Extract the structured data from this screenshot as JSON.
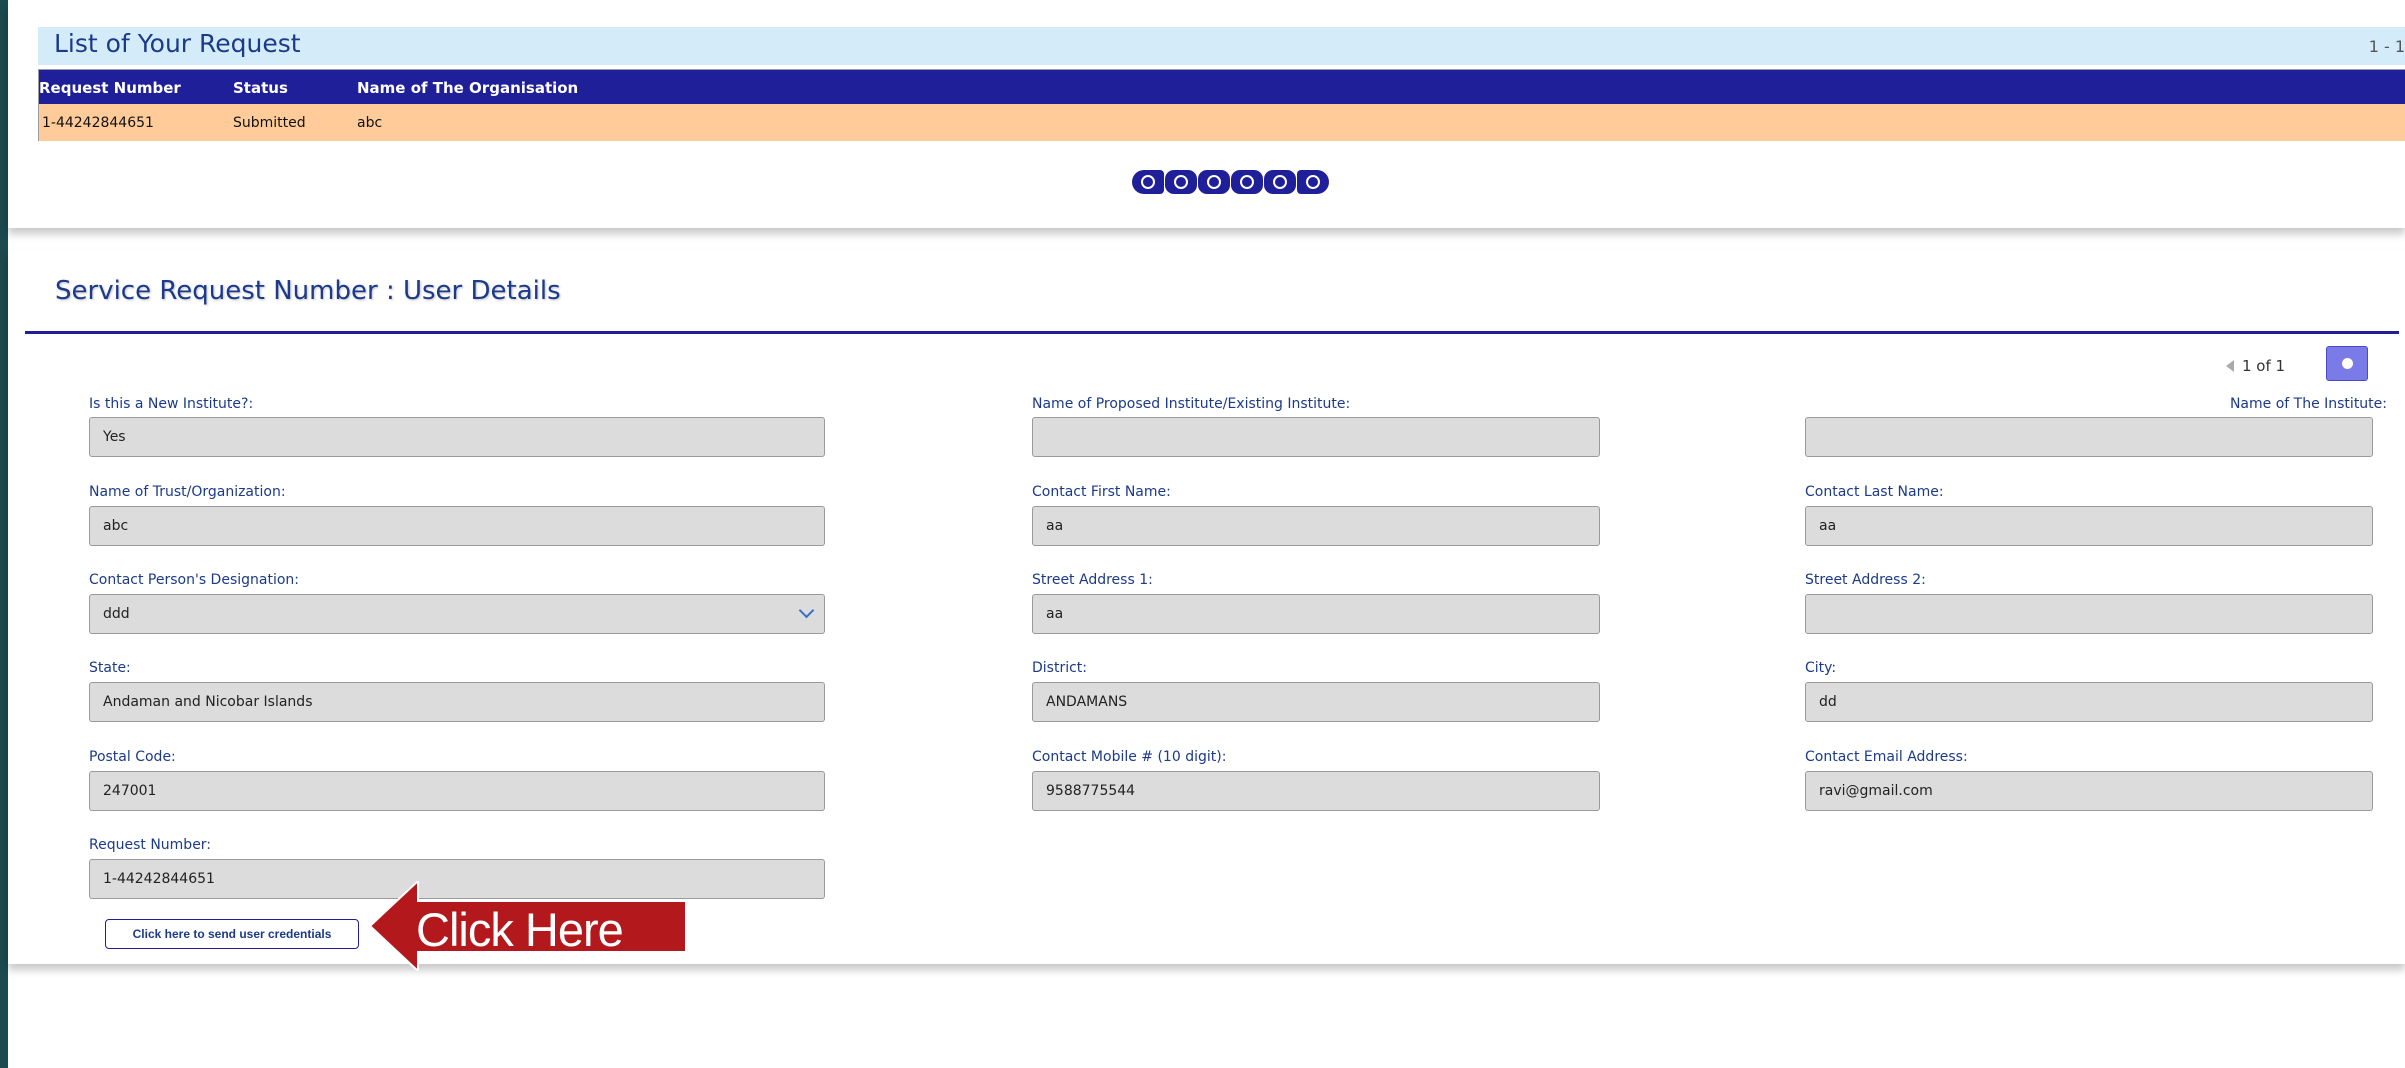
{
  "list": {
    "title": "List of Your Request",
    "count": "1 - 1",
    "columns": [
      "Request Number",
      "Status",
      "Name of The Organisation"
    ],
    "rows": [
      [
        "1-44242844651",
        "Submitted",
        "abc"
      ]
    ]
  },
  "details": {
    "title": "Service Request Number : User Details",
    "record_nav": "1 of 1",
    "fields": {
      "new_institute": {
        "label": "Is this a New Institute?:",
        "value": "Yes"
      },
      "proposed_name": {
        "label": "Name of Proposed Institute/Existing Institute:",
        "value": ""
      },
      "institute_name": {
        "label": "Name of The Institute:",
        "value": ""
      },
      "trust_name": {
        "label": "Name of Trust/Organization:",
        "value": "abc"
      },
      "first_name": {
        "label": "Contact First Name:",
        "value": "aa"
      },
      "last_name": {
        "label": "Contact Last Name:",
        "value": "aa"
      },
      "designation": {
        "label": "Contact Person's Designation:",
        "value": "ddd"
      },
      "street1": {
        "label": "Street Address 1:",
        "value": "aa"
      },
      "street2": {
        "label": "Street Address 2:",
        "value": ""
      },
      "state": {
        "label": "State:",
        "value": "Andaman and Nicobar Islands"
      },
      "district": {
        "label": "District:",
        "value": "ANDAMANS"
      },
      "city": {
        "label": "City:",
        "value": "dd"
      },
      "postal": {
        "label": "Postal Code:",
        "value": "247001"
      },
      "mobile": {
        "label": "Contact Mobile # (10 digit):",
        "value": "9588775544"
      },
      "email": {
        "label": "Contact Email Address:",
        "value": "ravi@gmail.com"
      },
      "request_number": {
        "label": "Request Number:",
        "value": "1-44242844651"
      }
    },
    "send_button": "Click here to send user credentials"
  },
  "callout": {
    "text": "Click Here",
    "color": "#b3191c"
  },
  "colors": {
    "header_bg": "#1f1f9a",
    "row_bg": "#ffcc99",
    "title_bg": "#d4ecf9",
    "frame": "#1b4b4f"
  },
  "icons": [
    "first-page-icon",
    "prev-page-icon",
    "prev-icon",
    "next-icon",
    "next-page-icon",
    "last-page-icon",
    "gear-icon",
    "chevron-down-icon",
    "arrow-left-icon"
  ]
}
